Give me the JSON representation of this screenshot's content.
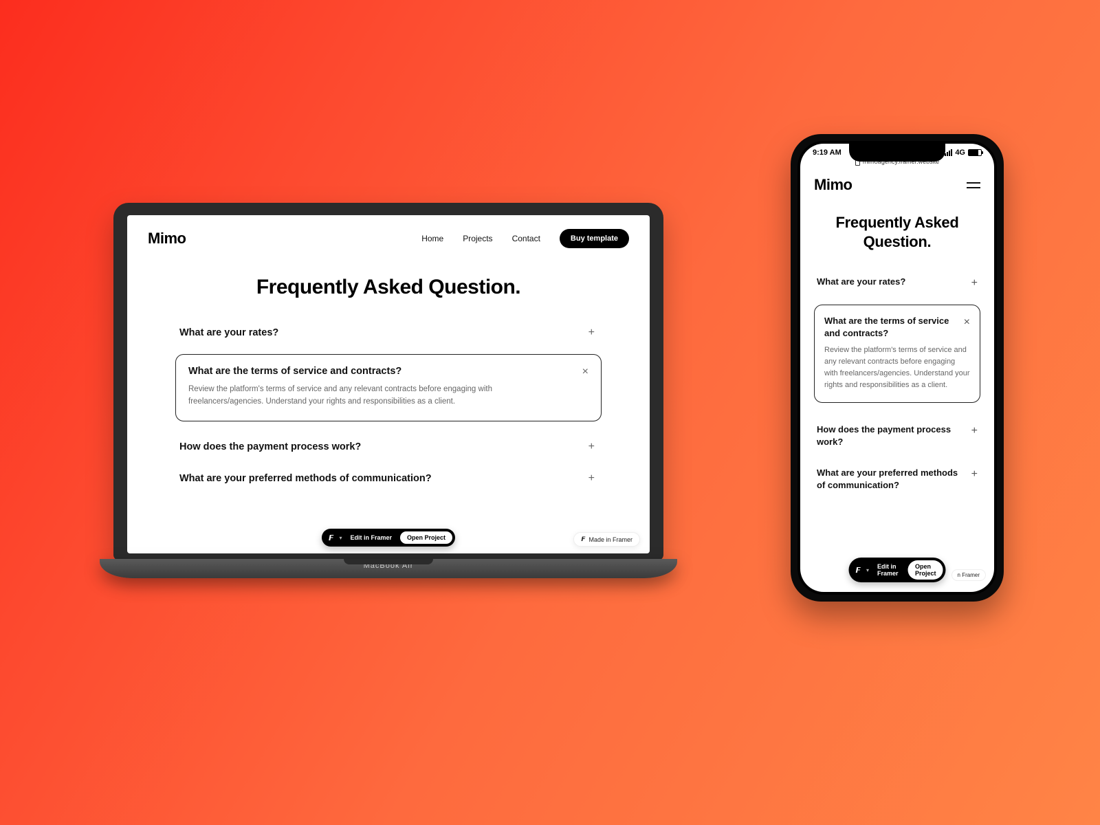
{
  "brand": "Mimo",
  "laptop": {
    "device_label": "MacBook Air",
    "nav": {
      "home": "Home",
      "projects": "Projects",
      "contact": "Contact"
    },
    "cta": "Buy template",
    "title": "Frequently Asked Question.",
    "faq": [
      {
        "q": "What are your rates?",
        "expanded": false
      },
      {
        "q": "What are the terms of service and contracts?",
        "expanded": true,
        "a": "Review the platform's terms of service and any relevant contracts before engaging with freelancers/agencies. Understand your rights and responsibilities as a client."
      },
      {
        "q": "How does the payment process work?",
        "expanded": false
      },
      {
        "q": "What are your preferred methods of communication?",
        "expanded": false
      }
    ],
    "toolbar": {
      "edit": "Edit in Framer",
      "open": "Open Project"
    },
    "badge": "Made in Framer"
  },
  "phone": {
    "status": {
      "time": "9:19 AM",
      "network": "4G"
    },
    "url": "mimoagency.framer.website",
    "title": "Frequently Asked Question.",
    "faq": [
      {
        "q": "What are your rates?",
        "expanded": false
      },
      {
        "q": "What are the terms of service and contracts?",
        "expanded": true,
        "a": "Review the platform's terms of service and any relevant contracts before engaging with freelancers/agencies. Understand your rights and responsibilities as a client."
      },
      {
        "q": "How does the payment process work?",
        "expanded": false
      },
      {
        "q": "What are your preferred methods of communication?",
        "expanded": false
      }
    ],
    "toolbar": {
      "edit": "Edit in Framer",
      "open": "Open Project"
    },
    "badge": "n Framer"
  }
}
